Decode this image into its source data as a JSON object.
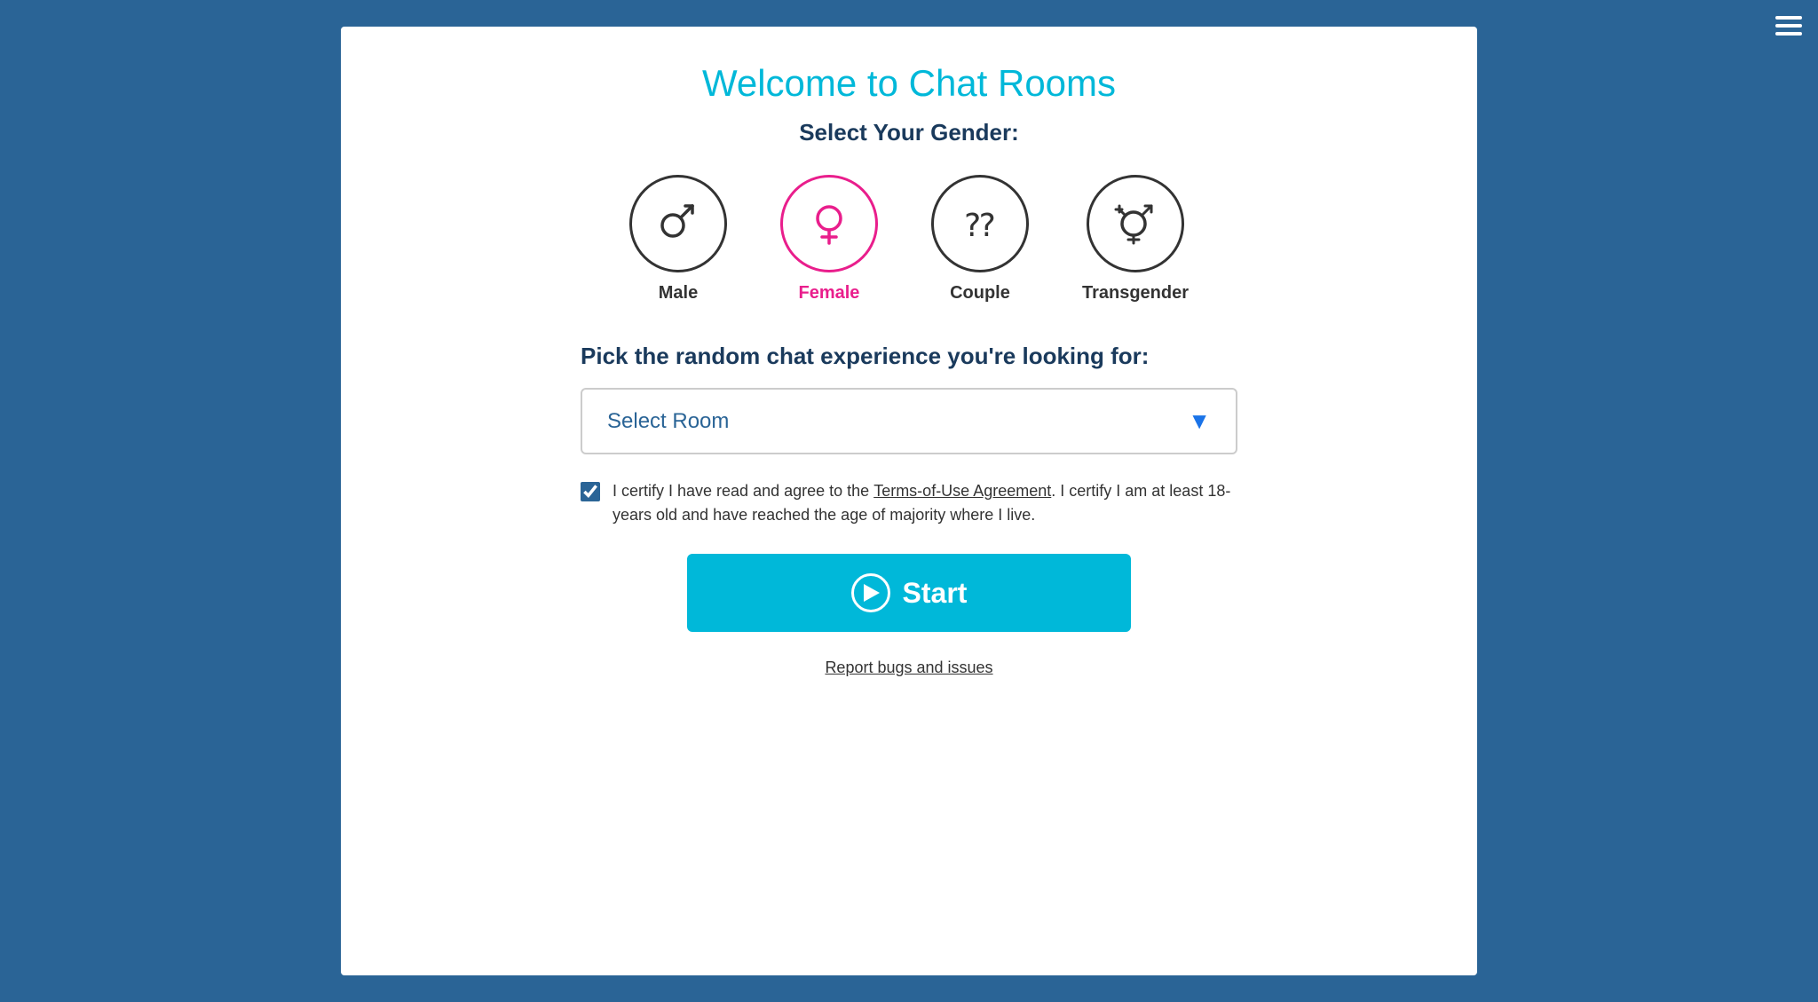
{
  "page": {
    "title": "Welcome to Chat Rooms",
    "background_color": "#2a6496"
  },
  "gender": {
    "section_label": "Select Your Gender:",
    "options": [
      {
        "id": "male",
        "label": "Male",
        "symbol": "♂",
        "selected": false
      },
      {
        "id": "female",
        "label": "Female",
        "symbol": "♀",
        "selected": true
      },
      {
        "id": "couple",
        "label": "Couple",
        "symbol": "⁇",
        "selected": false
      },
      {
        "id": "transgender",
        "label": "Transgender",
        "symbol": "⚧",
        "selected": false
      }
    ]
  },
  "room_select": {
    "experience_label": "Pick the random chat experience you're looking for:",
    "placeholder": "Select Room",
    "chevron": "▼"
  },
  "terms": {
    "checked": true,
    "text_before_link": "I certify I have read and agree to the ",
    "link_text": "Terms-of-Use Agreement",
    "text_after_link": ". I certify I am at least 18-years old and have reached the age of majority where I live."
  },
  "start_button": {
    "label": "Start"
  },
  "footer": {
    "report_link": "Report bugs and issues"
  }
}
